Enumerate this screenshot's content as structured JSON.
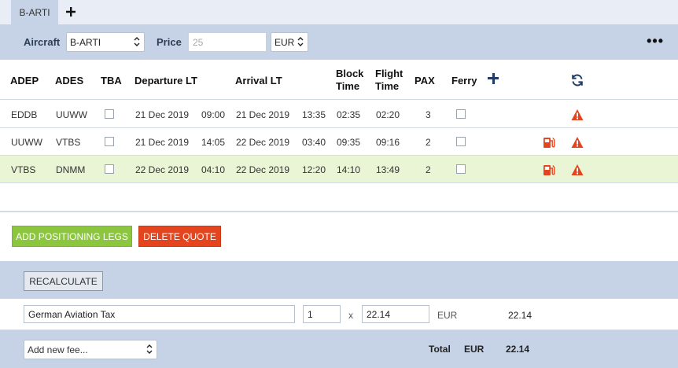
{
  "tabs": {
    "active_label": "B-ARTI",
    "add_label": "+"
  },
  "toolbar": {
    "aircraft_label": "Aircraft",
    "aircraft_value": "B-ARTI",
    "price_label": "Price",
    "price_placeholder": "25",
    "currency_value": "EUR",
    "more_label": "•••"
  },
  "table": {
    "headers": {
      "adep": "ADEP",
      "ades": "ADES",
      "tba": "TBA",
      "departure": "Departure LT",
      "arrival": "Arrival LT",
      "block_1": "Block",
      "block_2": "Time",
      "flight_1": "Flight",
      "flight_2": "Time",
      "pax": "PAX",
      "ferry": "Ferry"
    },
    "rows": [
      {
        "adep": "EDDB",
        "ades": "UUWW",
        "dep_date": "21 Dec 2019",
        "dep_time": "09:00",
        "arr_date": "21 Dec 2019",
        "arr_time": "13:35",
        "block": "02:35",
        "flight": "02:20",
        "pax": "3",
        "fuel_icon": false,
        "highlight": false
      },
      {
        "adep": "UUWW",
        "ades": "VTBS",
        "dep_date": "21 Dec 2019",
        "dep_time": "14:05",
        "arr_date": "22 Dec 2019",
        "arr_time": "03:40",
        "block": "09:35",
        "flight": "09:16",
        "pax": "2",
        "fuel_icon": true,
        "highlight": false
      },
      {
        "adep": "VTBS",
        "ades": "DNMM",
        "dep_date": "22 Dec 2019",
        "dep_time": "04:10",
        "arr_date": "22 Dec 2019",
        "arr_time": "12:20",
        "block": "14:10",
        "flight": "13:49",
        "pax": "2",
        "fuel_icon": true,
        "highlight": true
      }
    ]
  },
  "actions": {
    "add_positioning": "ADD POSITIONING LEGS",
    "delete_quote": "DELETE QUOTE",
    "recalculate": "RECALCULATE"
  },
  "fee": {
    "name": "German Aviation Tax",
    "quantity": "1",
    "times": "x",
    "unit_price": "22.14",
    "currency": "EUR",
    "amount": "22.14"
  },
  "footer": {
    "add_fee_placeholder": "Add new fee...",
    "total_label": "Total",
    "total_currency": "EUR",
    "total_amount": "22.14"
  },
  "colors": {
    "header_bar": "#c6d3e6",
    "highlight_row": "#eaf5d6",
    "add_positioning": "#8cc63f",
    "delete_quote": "#e4451f",
    "warning": "#e4451f",
    "accent": "#1f3c66"
  },
  "icons": {
    "tab_add": "plus-icon",
    "more": "more-horizontal-icon",
    "add_column": "plus-icon",
    "refresh": "refresh-icon",
    "warning": "warning-triangle-icon",
    "fuel": "fuel-pump-icon",
    "select": "chevron-updown-icon"
  }
}
